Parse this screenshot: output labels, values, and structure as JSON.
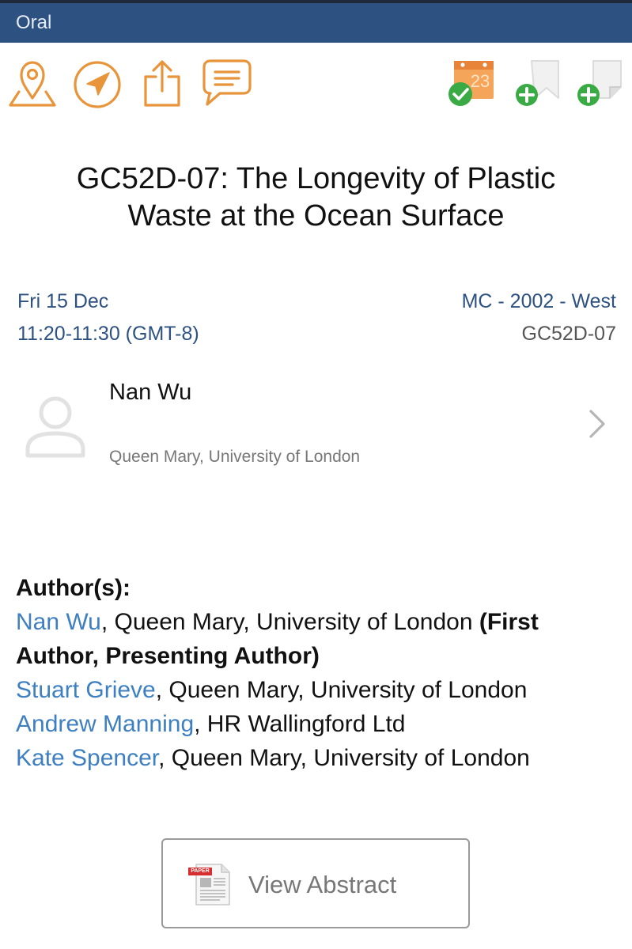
{
  "header": {
    "title": "Oral"
  },
  "toolbar": {
    "icons": [
      "map-location-icon",
      "navigation-icon",
      "share-icon",
      "comment-icon",
      "calendar-added-icon",
      "add-bookmark-icon",
      "add-note-icon"
    ],
    "calendar_day": "23",
    "accent_color": "#e8943a",
    "success_color": "#3aaa45"
  },
  "session": {
    "title": "GC52D-07: The Longevity of Plastic Waste at the Ocean Surface",
    "date": "Fri 15 Dec",
    "time": "11:20-11:30 (GMT-8)",
    "room": "MC - 2002 - West",
    "code": "GC52D-07"
  },
  "presenter": {
    "name": "Nan Wu",
    "affiliation": "Queen Mary, University of London"
  },
  "authors": {
    "heading": "Author(s):",
    "list": [
      {
        "name": "Nan Wu",
        "affiliation": ", Queen Mary, University of London ",
        "role_a": "(First",
        "role_b": "Author, Presenting Author)"
      },
      {
        "name": "Stuart Grieve",
        "affiliation": ", Queen Mary, University of London"
      },
      {
        "name": "Andrew Manning",
        "affiliation": ", HR Wallingford Ltd"
      },
      {
        "name": "Kate Spencer",
        "affiliation": ", Queen Mary, University of London"
      }
    ]
  },
  "abstract_button": {
    "label": "View Abstract",
    "badge": "PAPER"
  }
}
